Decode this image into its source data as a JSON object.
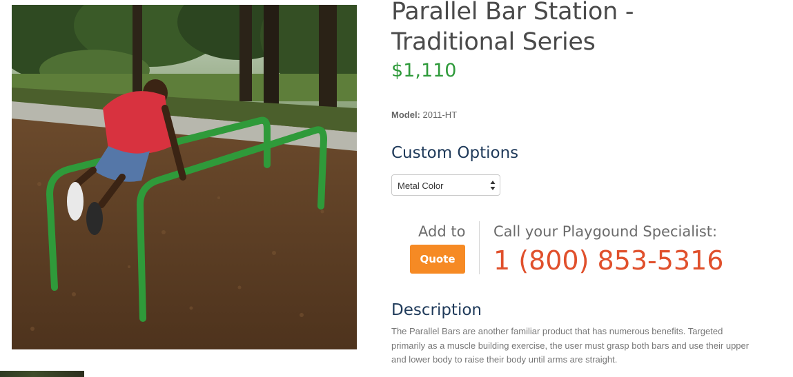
{
  "product": {
    "title_line1": "Parallel Bar Station -",
    "title_line2": "Traditional Series",
    "price": "$1,110",
    "model_label": "Model:",
    "model_value": "2011-HT"
  },
  "options": {
    "heading": "Custom Options",
    "select_value": "Metal Color"
  },
  "quote": {
    "add_to_label": "Add to",
    "button_label": "Quote"
  },
  "contact": {
    "call_label": "Call your Playgound Specialist:",
    "phone": "1 (800) 853-5316"
  },
  "description": {
    "heading": "Description",
    "text": "The Parallel Bars are another familiar product that has numerous benefits. Targeted primarily as a muscle building exercise, the user must grasp both bars and use their upper and lower body to raise their body until arms are straight."
  },
  "colors": {
    "price": "#2e9a3a",
    "heading": "#1f3a5a",
    "quote_button": "#f68a24",
    "phone": "#e0502c",
    "bar_green": "#2f9a3a"
  }
}
